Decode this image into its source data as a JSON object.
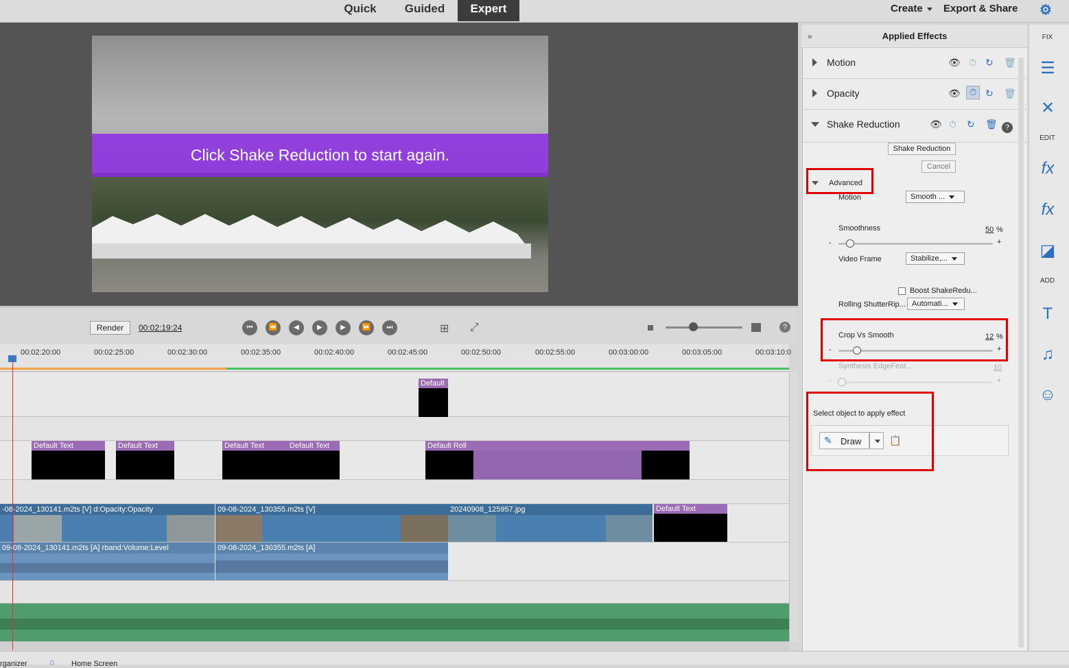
{
  "modes": {
    "quick": "Quick",
    "guided": "Guided",
    "expert": "Expert"
  },
  "topmenu": {
    "create": "Create",
    "export_share": "Export & Share"
  },
  "monitor": {
    "overlay_text": "Click Shake Reduction to start again."
  },
  "transport": {
    "render_label": "Render",
    "timecode": "00:02:19:24"
  },
  "ruler": {
    "ticks": [
      "00:02:20:00",
      "00:02:25:00",
      "00:02:30:00",
      "00:02:35:00",
      "00:02:40:00",
      "00:02:45:00",
      "00:02:50:00",
      "00:02:55:00",
      "00:03:00:00",
      "00:03:05:00",
      "00:03:10:0"
    ]
  },
  "tracks": {
    "title_top": "Default",
    "text_clips": [
      "Default Text",
      "Default Text",
      "Default Text",
      "Default Text"
    ],
    "roll_clip": "Default Roll",
    "video_clips": [
      "-08-2024_130141.m2ts [V] d:Opacity:Opacity",
      "09-08-2024_130355.m2ts [V]",
      "20240908_125957.jpg",
      "Default Text"
    ],
    "audio_clips": [
      "09-08-2024_130141.m2ts [A] rband:Volume:Level",
      "09-08-2024_130355.m2ts [A]"
    ]
  },
  "panel": {
    "title": "Applied Effects",
    "effects": [
      "Motion",
      "Opacity",
      "Shake Reduction"
    ],
    "shake_reduction_btn": "Shake Reduction",
    "cancel_btn": "Cancel",
    "advanced": "Advanced",
    "motion_label": "Motion",
    "motion_value": "Smooth ...",
    "smoothness_label": "Smoothness",
    "smoothness_value": "50",
    "smoothness_pct": 0.05,
    "video_frame_label": "Video Frame",
    "video_frame_value": "Stabilize,...",
    "boost_label": "Boost ShakeRedu...",
    "rolling_label": "Rolling ShutterRip...",
    "rolling_value": "Automati...",
    "crop_label": "Crop Vs Smooth",
    "crop_value": "12",
    "synthesis_label": "Synthesis EdgeFeat...",
    "synthesis_value": "10",
    "select_object_label": "Select object to apply effect",
    "draw_label": "Draw",
    "percent": "%",
    "minus": "-",
    "plus": "+"
  },
  "sidebar": {
    "fix": "FIX",
    "edit": "EDIT",
    "add": "ADD"
  },
  "bottom": {
    "organizer": "rganizer",
    "home": "Home Screen"
  }
}
